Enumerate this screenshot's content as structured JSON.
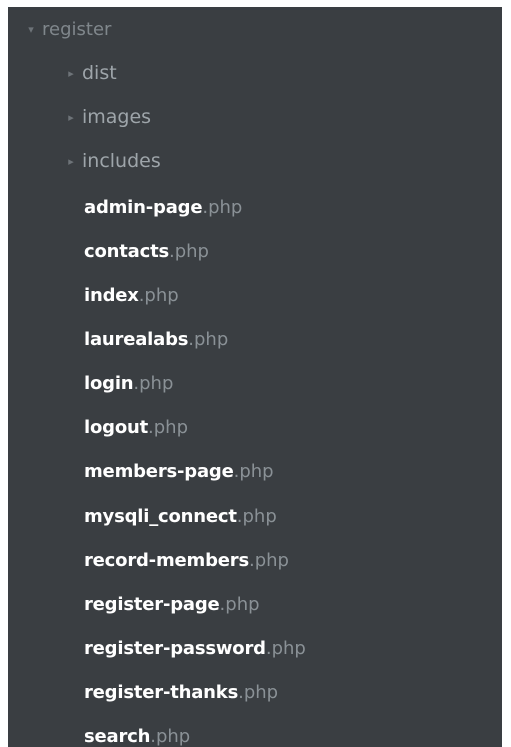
{
  "tree": {
    "root": {
      "name": "register",
      "expanded": true
    },
    "folders": [
      {
        "name": "dist",
        "expanded": false
      },
      {
        "name": "images",
        "expanded": false
      },
      {
        "name": "includes",
        "expanded": false
      }
    ],
    "files": [
      {
        "name": "admin-page",
        "ext": ".php"
      },
      {
        "name": "contacts",
        "ext": ".php"
      },
      {
        "name": "index",
        "ext": ".php"
      },
      {
        "name": "laurealabs",
        "ext": ".php"
      },
      {
        "name": "login",
        "ext": ".php"
      },
      {
        "name": "logout",
        "ext": ".php"
      },
      {
        "name": "members-page",
        "ext": ".php"
      },
      {
        "name": "mysqli_connect",
        "ext": ".php"
      },
      {
        "name": "record-members",
        "ext": ".php"
      },
      {
        "name": "register-page",
        "ext": ".php"
      },
      {
        "name": "register-password",
        "ext": ".php"
      },
      {
        "name": "register-thanks",
        "ext": ".php"
      },
      {
        "name": "search",
        "ext": ".php"
      }
    ],
    "icons": {
      "expanded": "▾",
      "collapsed": "▸"
    }
  }
}
